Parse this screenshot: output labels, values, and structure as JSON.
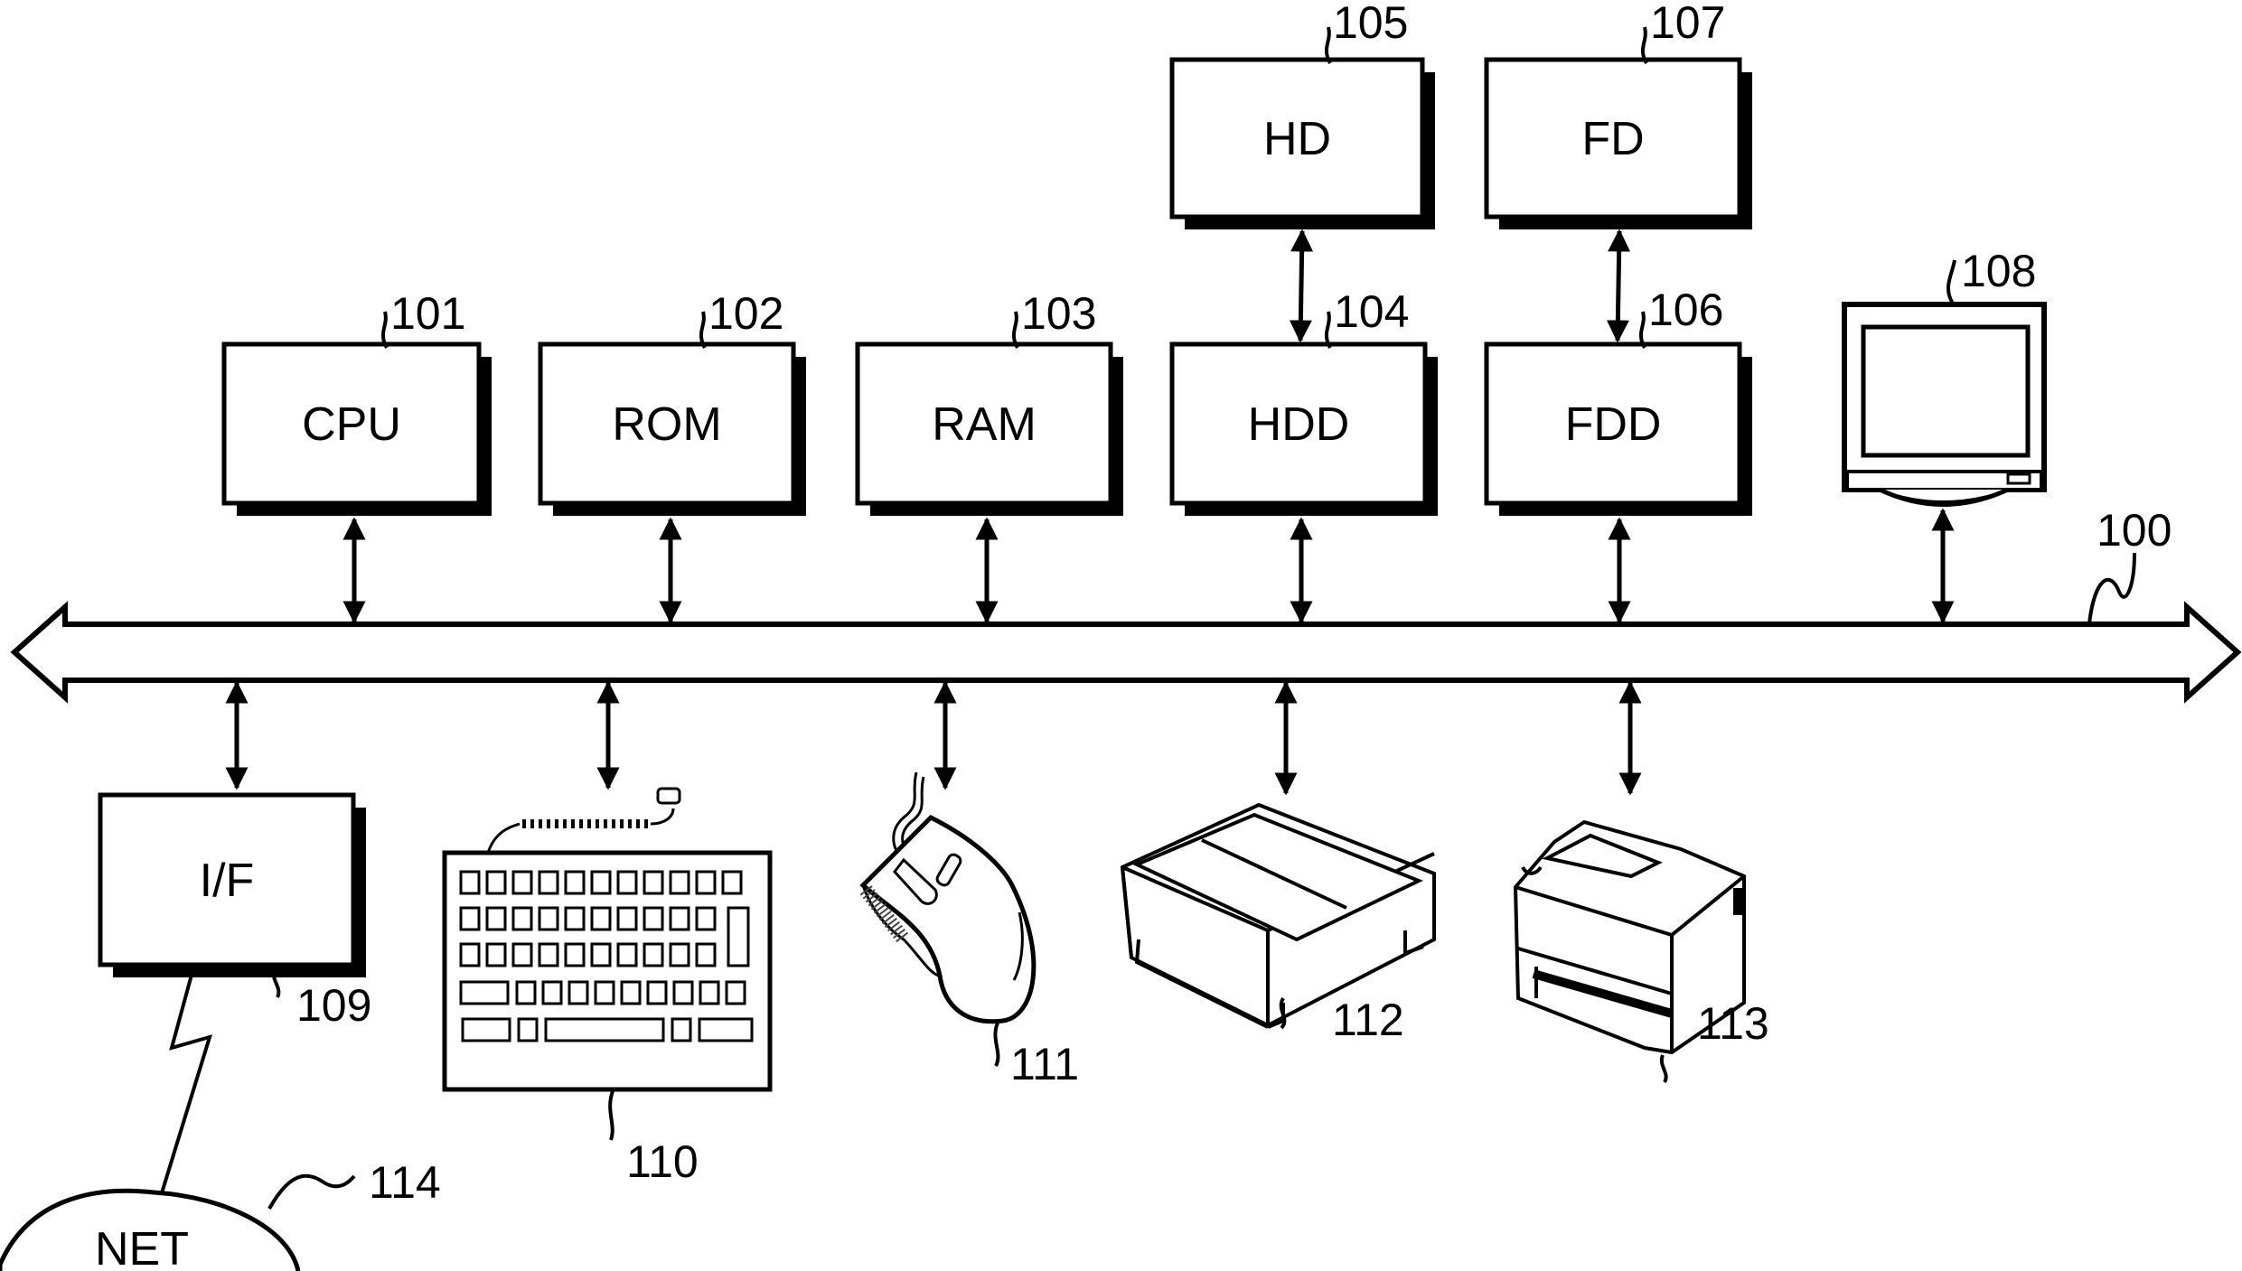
{
  "diagram": {
    "type": "system-block-diagram",
    "bus": {
      "ref": "100"
    },
    "blocks": [
      {
        "id": "cpu",
        "label": "CPU",
        "ref": "101"
      },
      {
        "id": "rom",
        "label": "ROM",
        "ref": "102"
      },
      {
        "id": "ram",
        "label": "RAM",
        "ref": "103"
      },
      {
        "id": "hdd",
        "label": "HDD",
        "ref": "104"
      },
      {
        "id": "hd",
        "label": "HD",
        "ref": "105"
      },
      {
        "id": "fdd",
        "label": "FDD",
        "ref": "106"
      },
      {
        "id": "fd",
        "label": "FD",
        "ref": "107"
      },
      {
        "id": "if",
        "label": "I/F",
        "ref": "109"
      }
    ],
    "devices": [
      {
        "id": "display",
        "icon": "monitor-icon",
        "ref": "108"
      },
      {
        "id": "keyboard",
        "icon": "keyboard-icon",
        "ref": "110"
      },
      {
        "id": "mouse",
        "icon": "mouse-icon",
        "ref": "111"
      },
      {
        "id": "scanner",
        "icon": "scanner-icon",
        "ref": "112"
      },
      {
        "id": "printer",
        "icon": "printer-icon",
        "ref": "113"
      }
    ],
    "network": {
      "label": "NET",
      "ref": "114"
    },
    "connections": [
      [
        "cpu",
        "bus"
      ],
      [
        "rom",
        "bus"
      ],
      [
        "ram",
        "bus"
      ],
      [
        "hdd",
        "bus"
      ],
      [
        "fdd",
        "bus"
      ],
      [
        "display",
        "bus"
      ],
      [
        "hd",
        "hdd"
      ],
      [
        "fd",
        "fdd"
      ],
      [
        "if",
        "bus"
      ],
      [
        "keyboard",
        "bus"
      ],
      [
        "mouse",
        "bus"
      ],
      [
        "scanner",
        "bus"
      ],
      [
        "printer",
        "bus"
      ],
      [
        "if",
        "network"
      ]
    ]
  }
}
